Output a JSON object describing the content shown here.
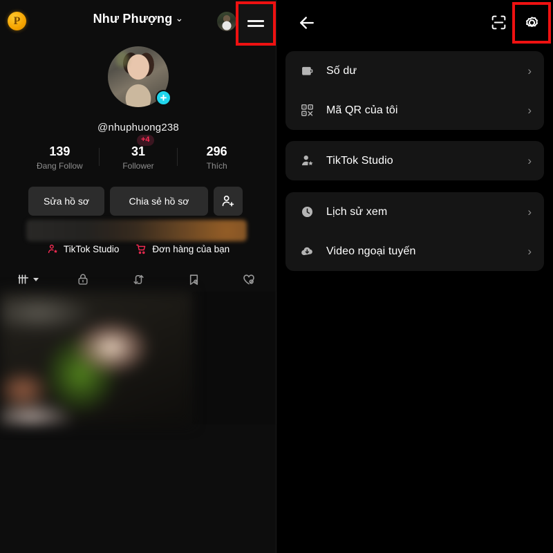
{
  "watermark": {
    "text": "P"
  },
  "left": {
    "header": {
      "title": "Như Phượng",
      "chevron": "⌄",
      "avatar_icon": "account-avatar",
      "menu_icon": "hamburger-menu-icon"
    },
    "profile": {
      "avatar_icon": "profile-avatar",
      "add_badge": "+",
      "handle": "@nhuphuong238"
    },
    "stats": [
      {
        "value": "139",
        "label": "Đang Follow",
        "badge": ""
      },
      {
        "value": "31",
        "label": "Follower",
        "badge": "+4"
      },
      {
        "value": "296",
        "label": "Thích",
        "badge": ""
      }
    ],
    "actions": {
      "edit_label": "Sửa hồ sơ",
      "share_label": "Chia sẻ hồ sơ",
      "add_friend_icon": "person-add-icon"
    },
    "quick_links": [
      {
        "label": "TikTok Studio",
        "icon": "person-star-icon"
      },
      {
        "label": "Đơn hàng của bạn",
        "icon": "shopping-cart-icon"
      }
    ],
    "tabs": [
      {
        "icon": "grid-posts-icon",
        "caret": true
      },
      {
        "icon": "lock-private-icon",
        "caret": false
      },
      {
        "icon": "repost-icon",
        "caret": false
      },
      {
        "icon": "bookmark-hidden-icon",
        "caret": false
      },
      {
        "icon": "heart-hidden-icon",
        "caret": false
      }
    ]
  },
  "right": {
    "header": {
      "back_icon": "back-arrow-icon",
      "scan_icon": "qr-scan-icon",
      "settings_icon": "gear-settings-icon"
    },
    "cards": [
      {
        "items": [
          {
            "label": "Số dư",
            "icon": "wallet-icon",
            "chevron": "›"
          },
          {
            "label": "Mã QR của tôi",
            "icon": "qr-code-icon",
            "chevron": "›"
          }
        ]
      },
      {
        "items": [
          {
            "label": "TikTok Studio",
            "icon": "person-star-icon",
            "chevron": "›"
          }
        ]
      },
      {
        "items": [
          {
            "label": "Lịch sử xem",
            "icon": "clock-history-icon",
            "chevron": "›"
          },
          {
            "label": "Video ngoại tuyến",
            "icon": "cloud-download-icon",
            "chevron": "›"
          }
        ]
      }
    ]
  },
  "colors": {
    "highlight_box": "#ee1111",
    "accent_pink": "#fe2c55",
    "accent_cyan": "#20d5ec",
    "background": "#000000",
    "card_background": "#151515"
  }
}
